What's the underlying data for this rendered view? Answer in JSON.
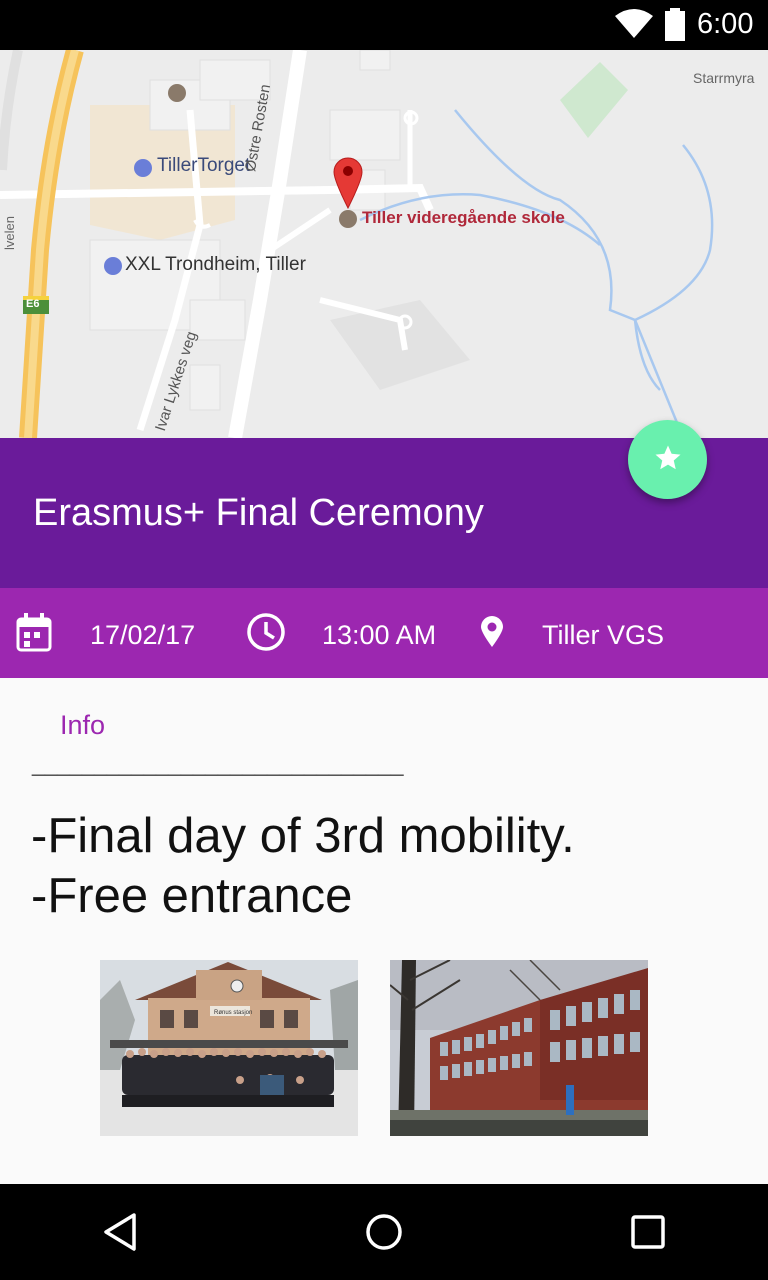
{
  "status_bar": {
    "time": "6:00",
    "icons": [
      "wifi-icon",
      "battery-icon"
    ]
  },
  "map": {
    "labels": {
      "tillertorget": "TillerTorget",
      "xxl": "XXL Trondheim, Tiller",
      "school": "Tiller videregående skole",
      "ostre_rosten": "Østre Rosten",
      "ivar_lykkes_veg": "Ivar Lykkes veg",
      "starrmyra": "Starrmyra",
      "e6": "E6",
      "left_road": "lvelen"
    }
  },
  "event": {
    "title": "Erasmus+ Final Ceremony",
    "date": "17/02/17",
    "time": "13:00 AM",
    "location": "Tiller VGS"
  },
  "content": {
    "info_label": "Info",
    "divider": "______________________________",
    "description": "-Final day of 3rd mobility.\n-Free entrance"
  },
  "photos": {
    "station_sign": "Rønus stasjon"
  },
  "colors": {
    "title_band": "#6a1b9a",
    "details_band": "#9c27b0",
    "fab": "#69f0ae",
    "accent_text": "#9c27b0"
  }
}
